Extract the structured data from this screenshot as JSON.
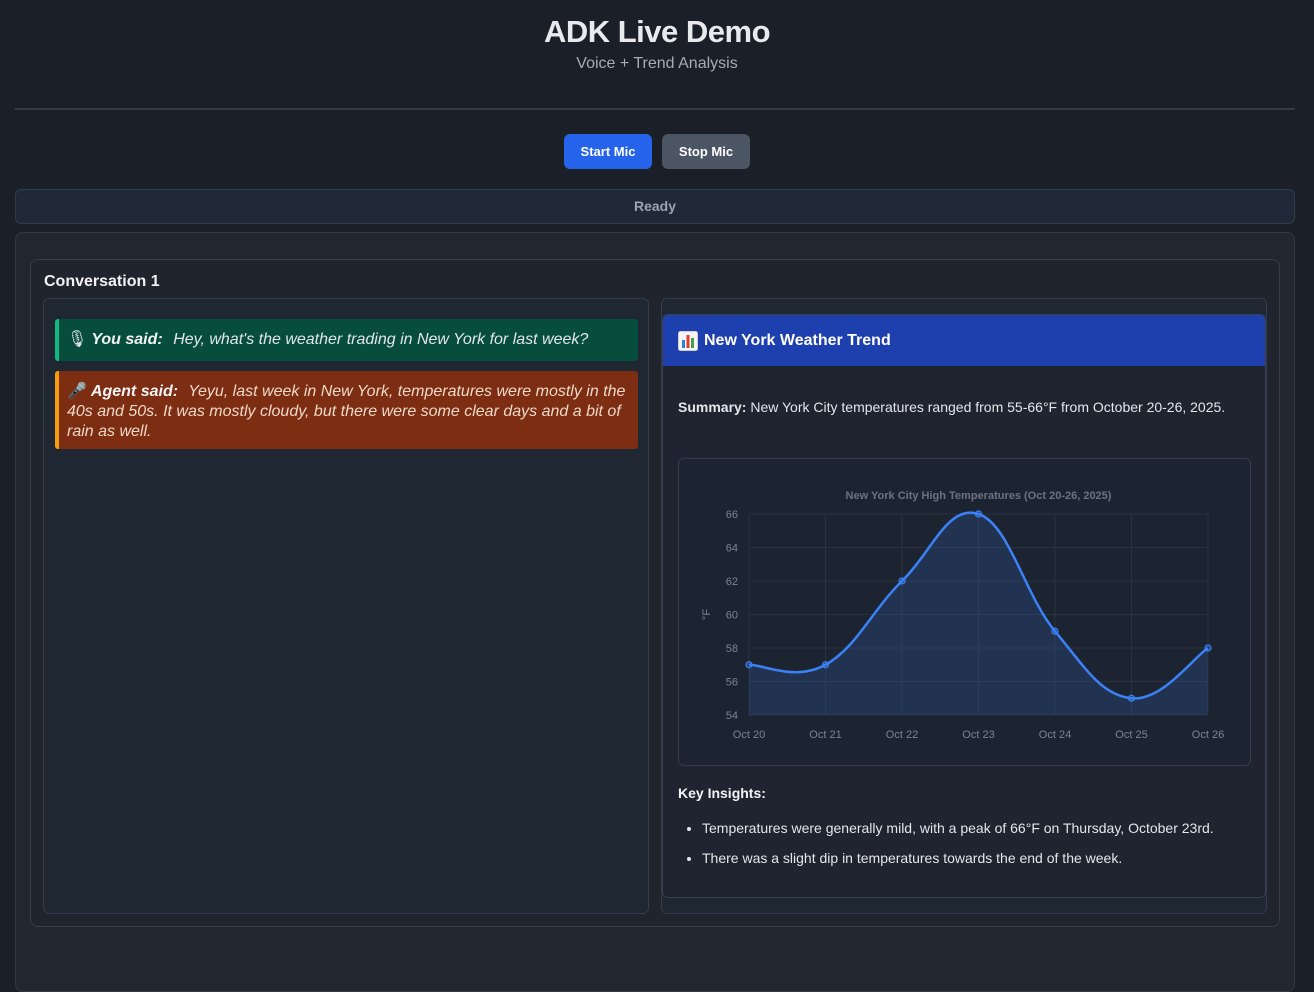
{
  "header": {
    "title": "ADK Live Demo",
    "subtitle": "Voice + Trend Analysis"
  },
  "controls": {
    "start_label": "Start Mic",
    "stop_label": "Stop Mic"
  },
  "status": {
    "text": "Ready"
  },
  "conversation": {
    "title": "Conversation 1",
    "messages": [
      {
        "role": "user",
        "icon": "microphone-icon",
        "icon_glyph": "🎙",
        "label": "You said:",
        "text": "Hey, what's the weather trading in New York for last week?"
      },
      {
        "role": "agent",
        "icon": "microphone-icon",
        "icon_glyph": "🎤",
        "label": "Agent said:",
        "text": "Yeyu, last week in New York, temperatures were mostly in the 40s and 50s. It was mostly cloudy, but there were some clear days and a bit of rain as well."
      }
    ]
  },
  "card": {
    "icon": "bar-chart-icon",
    "title": "New York Weather Trend",
    "summary_label": "Summary:",
    "summary_text": "New York City temperatures ranged from 55-66°F from October 20-26, 2025.",
    "insights_title": "Key Insights:",
    "insights": [
      "Temperatures were generally mild, with a peak of 66°F on Thursday, October 23rd.",
      "There was a slight dip in temperatures towards the end of the week."
    ]
  },
  "colors": {
    "accent": "#2563eb",
    "line": "#3b82f6",
    "user_bubble": "#064e3b",
    "agent_bubble": "#7c2d12"
  },
  "chart_data": {
    "type": "line",
    "title": "New York City High Temperatures (Oct 20-26, 2025)",
    "xlabel": "",
    "ylabel": "°F",
    "categories": [
      "Oct 20",
      "Oct 21",
      "Oct 22",
      "Oct 23",
      "Oct 24",
      "Oct 25",
      "Oct 26"
    ],
    "series": [
      {
        "values": [
          57,
          57,
          62,
          66,
          59,
          55,
          58
        ]
      }
    ],
    "ylim": [
      54,
      66
    ],
    "yticks": [
      54,
      56,
      58,
      60,
      62,
      64,
      66
    ],
    "grid": true,
    "legend": "none"
  }
}
